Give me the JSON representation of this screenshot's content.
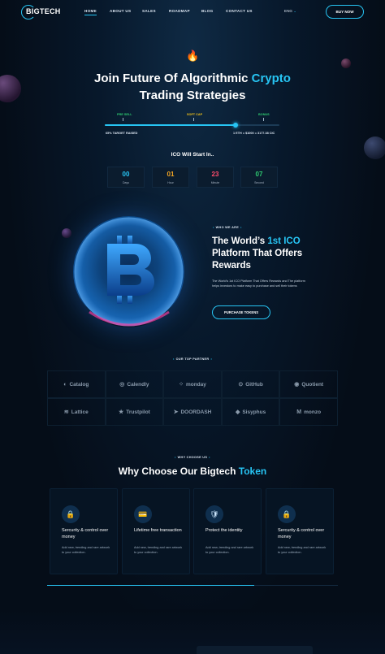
{
  "header": {
    "logo": "BIGTECH",
    "nav": [
      {
        "label": "HOME",
        "active": true
      },
      {
        "label": "ABOUT US"
      },
      {
        "label": "SALES"
      },
      {
        "label": "ROADMAP"
      },
      {
        "label": "BLOG"
      },
      {
        "label": "CONTACT US"
      }
    ],
    "language": "ENG",
    "buy_label": "BUY NOW"
  },
  "hero": {
    "icon": "flame-icon",
    "title_part1": "Join Future Of Algorithmic ",
    "title_highlight": "Crypto",
    "title_line2": "Trading Strategies",
    "stages": [
      {
        "label": "PRE SELL",
        "color": "#2ecc71"
      },
      {
        "label": "SOFT CAP",
        "color": "#f5c518"
      },
      {
        "label": "BONUS",
        "color": "#2ecc71"
      }
    ],
    "progress": 0.75,
    "raised_text": "65% TARGET RAISED",
    "rate_text": "1 ETH = $1000 = 3177.38 CIC",
    "ico_title": "ICO Will Start In..",
    "countdown": [
      {
        "value": "00",
        "label": "Days",
        "color": "#27c5f4"
      },
      {
        "value": "01",
        "label": "Hour",
        "color": "#f5a623"
      },
      {
        "value": "23",
        "label": "Minute",
        "color": "#ff4d6d"
      },
      {
        "value": "07",
        "label": "Second",
        "color": "#2ecc71"
      }
    ]
  },
  "about": {
    "tag": "WHO WE ARE",
    "title_part1": "The World’s ",
    "title_highlight": "1st ICO",
    "title_part2": "Platform That Offers Rewards",
    "text": "The World’s 1st ICO Platform That Offers Rewards and The platform helps investors to make easy to purchase and sell their tokens",
    "button": "PURCHASE TOKENS"
  },
  "partners": {
    "tag": "OUR TOP PARTNER",
    "items": [
      {
        "name": "Catalog",
        "icon": "◐"
      },
      {
        "name": "Calendly",
        "icon": "◎"
      },
      {
        "name": "monday",
        "icon": "⁘"
      },
      {
        "name": "GitHub",
        "icon": "⊙"
      },
      {
        "name": "Quotient",
        "icon": "◉"
      },
      {
        "name": "Lattice",
        "icon": "≋"
      },
      {
        "name": "Trustpilot",
        "icon": "★"
      },
      {
        "name": "DOORDASH",
        "icon": "➤"
      },
      {
        "name": "Sisyphus",
        "icon": "◆"
      },
      {
        "name": "monzo",
        "icon": "M"
      }
    ]
  },
  "why": {
    "tag": "WHY CHOOSE US",
    "title_part1": "Why Choose Our Bigtech ",
    "title_highlight": "Token",
    "cards": [
      {
        "icon": "lock-icon",
        "glyph": "🔒",
        "title": "Sercurity & control over money",
        "text": "Add new, trending and rare artwork to your collection."
      },
      {
        "icon": "card-icon",
        "glyph": "💳",
        "title": "Lifetime free transaction",
        "text": "Add new, trending and rare artwork to your collection."
      },
      {
        "icon": "shield-icon",
        "glyph": "🛡",
        "title": "Protect the identity",
        "text": "Add new, trending and rare artwork to your collection."
      },
      {
        "icon": "lock-icon",
        "glyph": "🔒",
        "title": "Sercurity & control over money",
        "text": "Add new, trending and rare artwork to your collection."
      }
    ]
  },
  "colors": {
    "accent": "#27c5f4",
    "background": "#050d18"
  }
}
